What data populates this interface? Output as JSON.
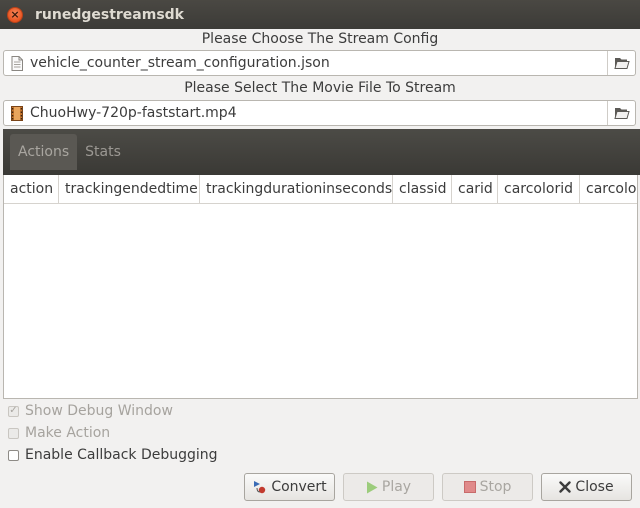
{
  "window": {
    "title": "runedgestreamsdk"
  },
  "config": {
    "label": "Please Choose The Stream Config",
    "file": "vehicle_counter_stream_configuration.json"
  },
  "movie": {
    "label": "Please Select The Movie File To Stream",
    "file": "ChuoHwy-720p-faststart.mp4"
  },
  "tabs": [
    {
      "label": "Actions",
      "active": true
    },
    {
      "label": "Stats",
      "active": false
    }
  ],
  "table": {
    "columns": [
      "action",
      "trackingendedtime",
      "trackingdurationinseconds",
      "classid",
      "carid",
      "carcolorid",
      "carcolo"
    ],
    "rows": []
  },
  "options": {
    "show_debug_window": {
      "label": "Show Debug Window",
      "checked": true,
      "enabled": false
    },
    "make_action": {
      "label": "Make Action",
      "checked": false,
      "enabled": false
    },
    "enable_callback_debugging": {
      "label": "Enable Callback Debugging",
      "checked": false,
      "enabled": true
    }
  },
  "buttons": {
    "convert": "Convert",
    "play": "Play",
    "stop": "Stop",
    "close": "Close"
  },
  "colors": {
    "titlebar": "#3c3b37",
    "close_icon": "#e95420",
    "play_icon": "#9ccc7c",
    "stop_icon": "#e08a8a"
  }
}
